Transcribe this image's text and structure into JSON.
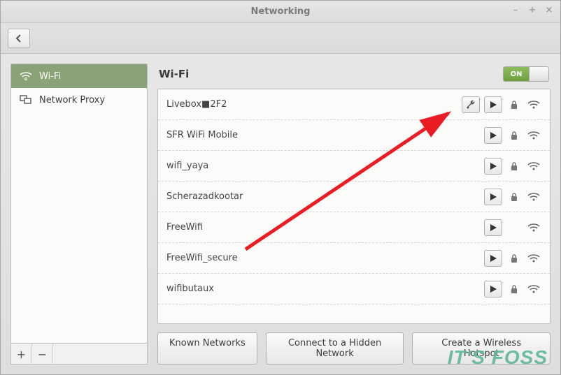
{
  "window": {
    "title": "Networking"
  },
  "sidebar": {
    "items": [
      {
        "label": "Wi-Fi",
        "icon": "wifi-icon",
        "active": true
      },
      {
        "label": "Network Proxy",
        "icon": "proxy-icon",
        "active": false
      }
    ]
  },
  "main": {
    "heading": "Wi-Fi",
    "toggle": {
      "state": "ON"
    },
    "networks": [
      {
        "name": "Livebox■2F2",
        "configurable": true,
        "secure": true
      },
      {
        "name": "SFR WiFi Mobile",
        "configurable": false,
        "secure": true
      },
      {
        "name": "wifi_yaya",
        "configurable": false,
        "secure": true
      },
      {
        "name": "Scherazadkootar",
        "configurable": false,
        "secure": true
      },
      {
        "name": "FreeWifi",
        "configurable": false,
        "secure": false
      },
      {
        "name": "FreeWifi_secure",
        "configurable": false,
        "secure": true
      },
      {
        "name": "wifibutaux",
        "configurable": false,
        "secure": true
      }
    ],
    "buttons": {
      "known": "Known Networks",
      "hidden": "Connect to a Hidden Network",
      "hotspot": "Create a Wireless Hotspot"
    }
  },
  "watermark": "IT'S FOSS"
}
